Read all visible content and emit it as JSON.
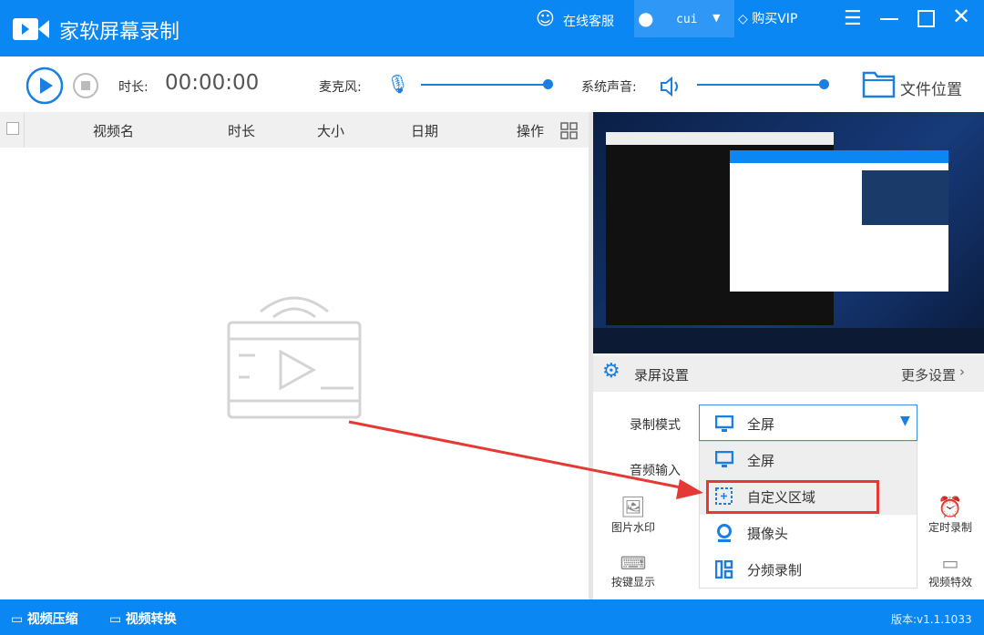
{
  "app": {
    "title": "家软屏幕录制",
    "support": "在线客服",
    "user": "cui",
    "vip": "购买VIP"
  },
  "toolbar": {
    "duration_label": "时长:",
    "duration": "00:00:00",
    "mic_label": "麦克风:",
    "system_audio_label": "系统声音:",
    "file_location": "文件位置",
    "mic_level": 100,
    "system_level": 100
  },
  "table": {
    "headers": [
      "视频名",
      "时长",
      "大小",
      "日期",
      "操作"
    ]
  },
  "settings": {
    "title": "录屏设置",
    "more": "更多设置",
    "mode_label": "录制模式",
    "mode_value": "全屏",
    "audio_label": "音频输入",
    "options": [
      "全屏",
      "自定义区域",
      "摄像头",
      "分频录制"
    ],
    "tools_left": [
      "图片水印",
      "按键显示"
    ],
    "tools_right": [
      "定时录制",
      "视频特效"
    ]
  },
  "footer": {
    "compress": "视频压缩",
    "convert": "视频转换",
    "version": "版本:v1.1.1033"
  },
  "colors": {
    "brand": "#0a87f2",
    "highlight": "#e53935"
  }
}
